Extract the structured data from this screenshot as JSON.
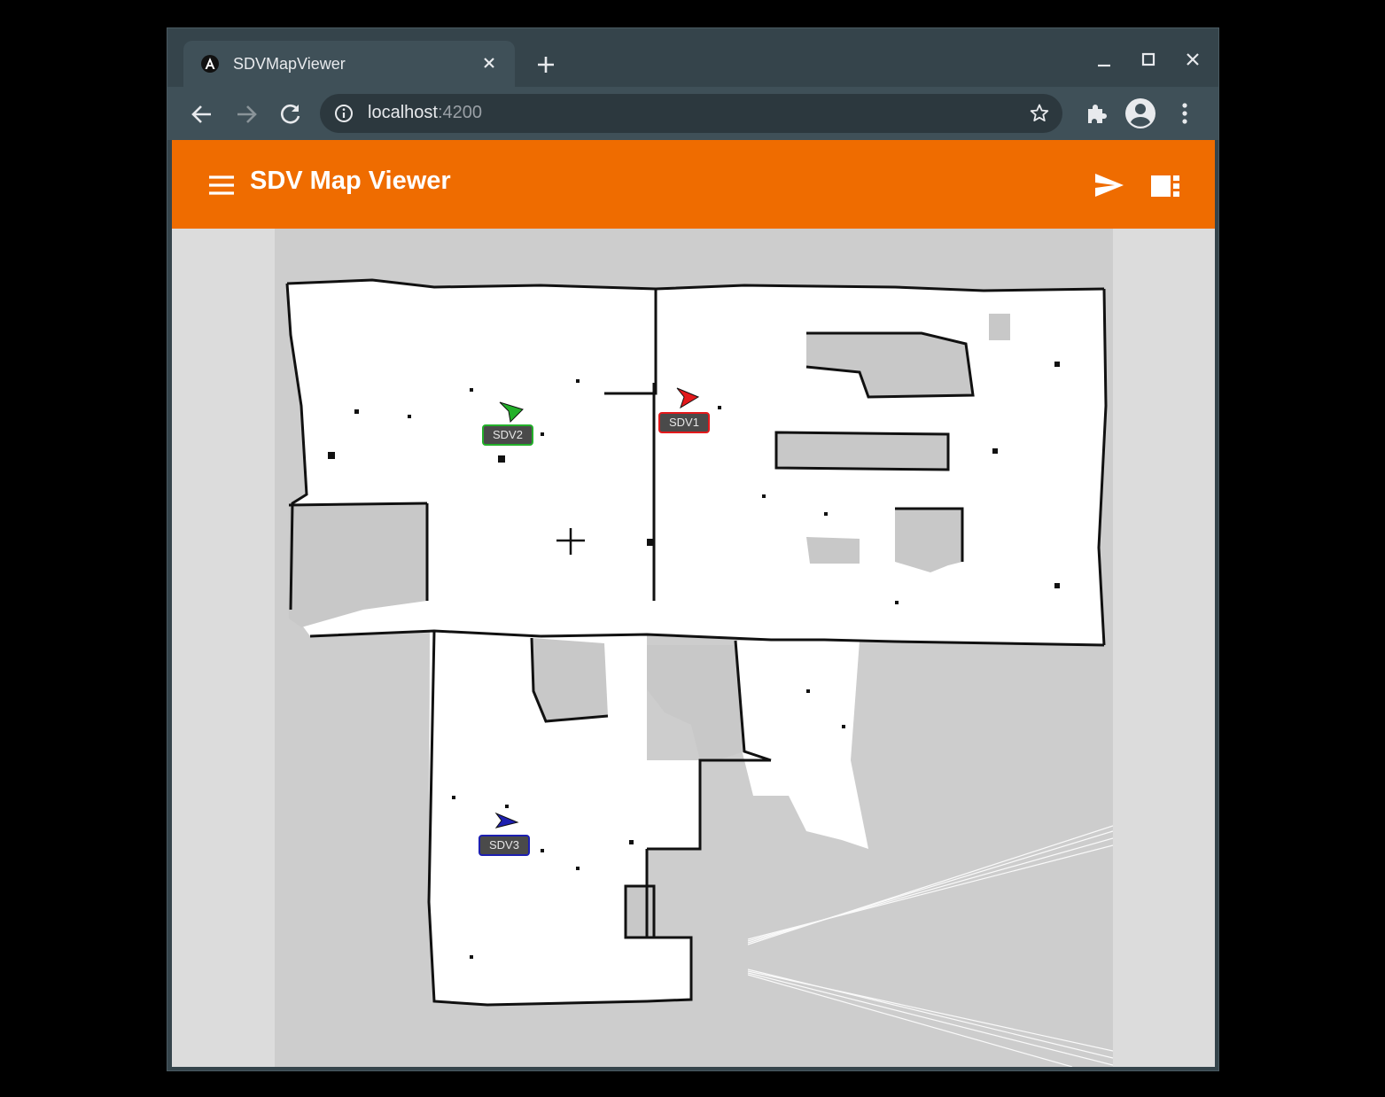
{
  "browser": {
    "tab_title": "SDVMapViewer",
    "url_host": "localhost",
    "url_port": ":4200"
  },
  "app": {
    "title": "SDV Map Viewer",
    "accent": "#ef6c00"
  },
  "robots": [
    {
      "name": "SDV1",
      "color": "#e3191c"
    },
    {
      "name": "SDV2",
      "color": "#23b02a"
    },
    {
      "name": "SDV3",
      "color": "#1d1fb0"
    }
  ]
}
